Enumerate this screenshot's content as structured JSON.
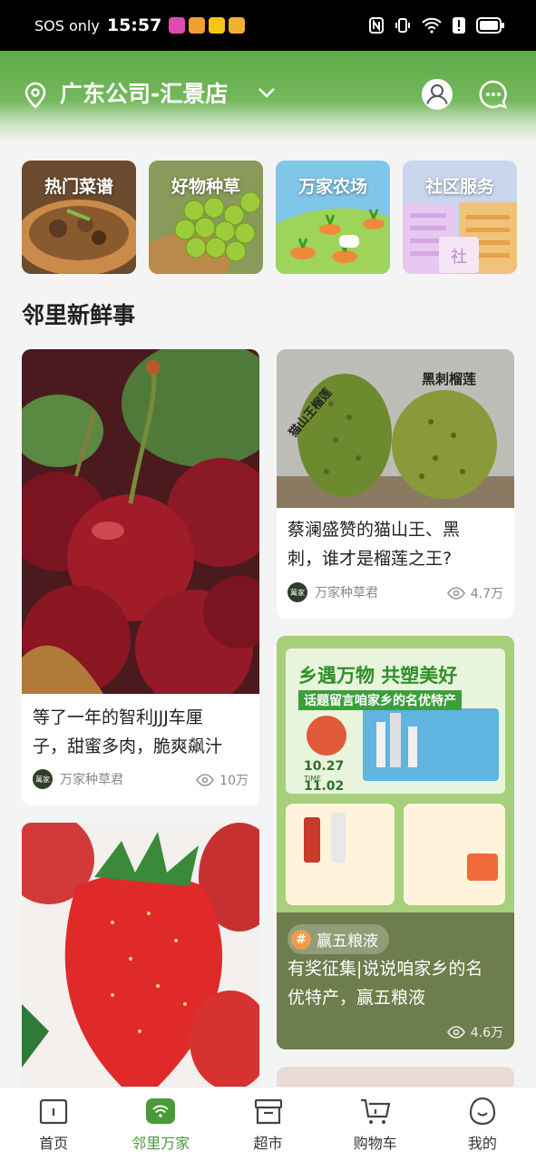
{
  "status_bar": {
    "carrier": "SOS only",
    "time": "15:57"
  },
  "header": {
    "store_name": "广东公司-汇景店"
  },
  "quick_categories": [
    {
      "label": "热门菜谱"
    },
    {
      "label": "好物种草"
    },
    {
      "label": "万家农场"
    },
    {
      "label": "社区服务"
    }
  ],
  "section_title": "邻里新鲜事",
  "feed": {
    "cherry": {
      "title_line1": "等了一年的智利JJJ车厘",
      "title_line2": "子，甜蜜多肉，脆爽飙汁",
      "author": "万家种草君",
      "views": "10万"
    },
    "durian": {
      "img_label_left": "猫山王榴莲",
      "img_label_right": "黑刺榴莲",
      "title_line1": "蔡澜盛赞的猫山王、黑",
      "title_line2": "刺，谁才是榴莲之王?",
      "author": "万家种草君",
      "views": "4.7万"
    },
    "promo": {
      "banner_headline": "乡遇万物 共塑美好",
      "banner_sub": "话题留言咱家乡的名优特产",
      "banner_date_start": "10.27",
      "banner_date_end": "11.02",
      "banner_time_label": "TIME",
      "topic": "赢五粮液",
      "title_line1": "有奖征集|说说咱家乡的名",
      "title_line2": "优特产，赢五粮液",
      "views": "4.6万"
    }
  },
  "author_logo_text": "萬家",
  "bottom_nav": [
    {
      "label": "首页",
      "icon": "home-icon"
    },
    {
      "label": "邻里万家",
      "icon": "neighbor-icon"
    },
    {
      "label": "超市",
      "icon": "store-icon"
    },
    {
      "label": "购物车",
      "icon": "cart-icon"
    },
    {
      "label": "我的",
      "icon": "profile-icon"
    }
  ],
  "colors": {
    "brand_green": "#5faa47",
    "active_nav": "#4a9a3a"
  }
}
